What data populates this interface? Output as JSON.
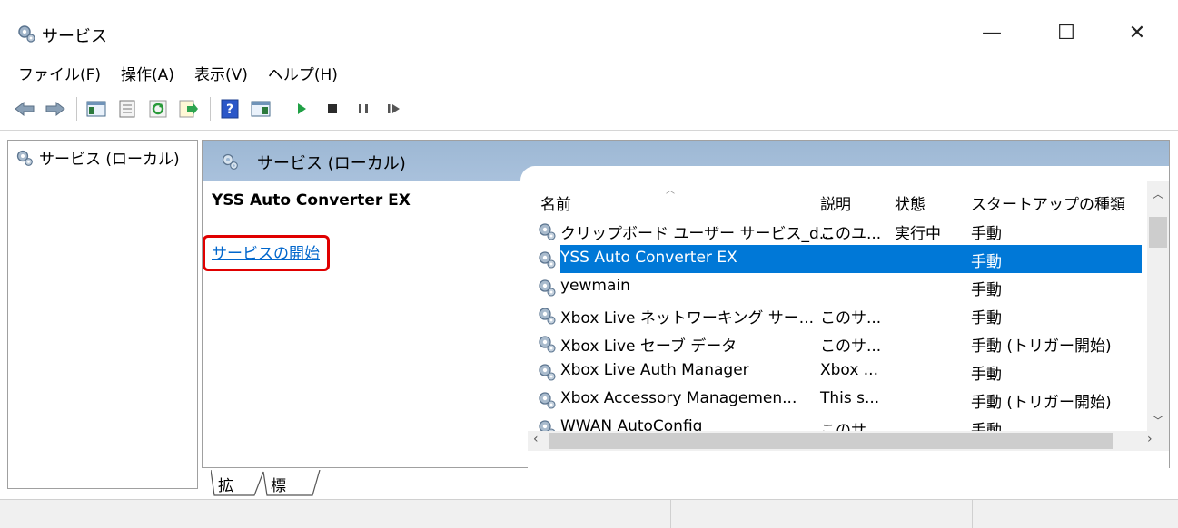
{
  "window": {
    "title": "サービス",
    "minimize_glyph": "—",
    "maximize_glyph": "☐",
    "close_glyph": "✕"
  },
  "menu": [
    "ファイル(F)",
    "操作(A)",
    "表示(V)",
    "ヘルプ(H)"
  ],
  "toolbar_icons": [
    "back-icon",
    "forward-icon",
    "show-hide-console-tree-icon",
    "properties-icon",
    "refresh-icon",
    "export-list-icon",
    "help-icon",
    "show-hide-action-pane-icon",
    "start-service-icon",
    "stop-service-icon",
    "pause-service-icon",
    "resume-service-icon"
  ],
  "tree": {
    "node_label": "サービス (ローカル)"
  },
  "main": {
    "header_title": "サービス (ローカル)",
    "selected_service_title": "YSS Auto Converter EX",
    "start_link": "サービスの開始"
  },
  "list": {
    "columns": [
      "名前",
      "説明",
      "状態",
      "スタートアップの種類"
    ],
    "rows": [
      {
        "name": "クリップボード ユーザー サービス_d...",
        "desc": "このユ...",
        "status": "実行中",
        "startup": "手動"
      },
      {
        "name": "YSS Auto Converter EX",
        "desc": "",
        "status": "",
        "startup": "手動"
      },
      {
        "name": "yewmain",
        "desc": "",
        "status": "",
        "startup": "手動"
      },
      {
        "name": "Xbox Live ネットワーキング サー...",
        "desc": "このサ...",
        "status": "",
        "startup": "手動"
      },
      {
        "name": "Xbox Live セーブ データ",
        "desc": "このサ...",
        "status": "",
        "startup": "手動 (トリガー開始)"
      },
      {
        "name": "Xbox Live Auth Manager",
        "desc": "Xbox ...",
        "status": "",
        "startup": "手動"
      },
      {
        "name": "Xbox Accessory Managemen...",
        "desc": "This s...",
        "status": "",
        "startup": "手動 (トリガー開始)"
      },
      {
        "name": "WWAN AutoConfig",
        "desc": "このサ...",
        "status": "",
        "startup": "手動"
      }
    ],
    "selected_index": 1
  },
  "tabs": [
    "拡張",
    "標準"
  ],
  "colors": {
    "selection": "#0078d7",
    "header": "#a9c1dc",
    "link": "#0066cc",
    "highlight_box": "#e00000"
  }
}
